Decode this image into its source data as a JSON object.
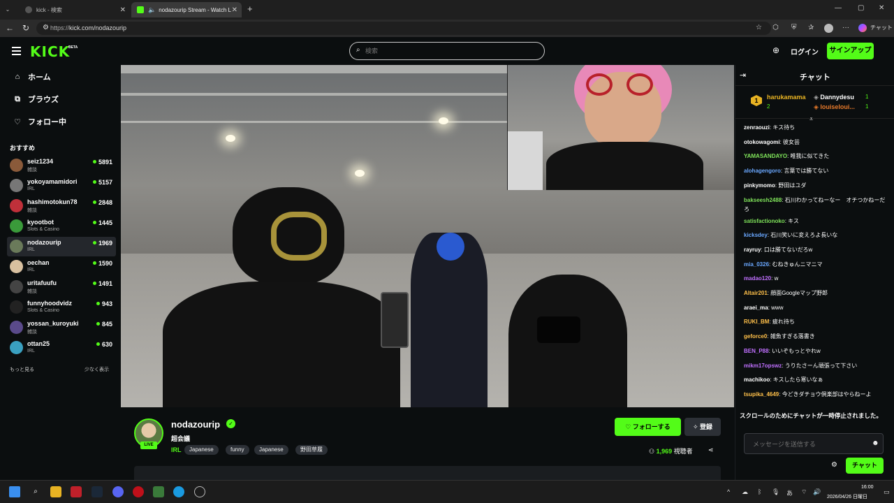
{
  "browser": {
    "tabs": [
      {
        "title": "kick - 検索",
        "active": false
      },
      {
        "title": "nodazourip Stream - Watch L",
        "active": true
      }
    ],
    "url_prefix": "https://",
    "url_main": "kick.com/nodazourip",
    "chat_ext_label": "チャット"
  },
  "header": {
    "logo": "KICK",
    "logo_badge": "BETA",
    "search_placeholder": "検索",
    "login": "ログイン",
    "signup": "サインアップ"
  },
  "sidebar": {
    "nav": [
      {
        "label": "ホーム",
        "icon": "home-icon"
      },
      {
        "label": "ブラウズ",
        "icon": "browse-icon"
      },
      {
        "label": "フォロー中",
        "icon": "heart-icon"
      }
    ],
    "recommended_title": "おすすめ",
    "channels": [
      {
        "name": "seiz1234",
        "category": "雑談",
        "viewers": "5891",
        "color": "#8a5a3a"
      },
      {
        "name": "yokoyamamidori",
        "category": "IRL",
        "viewers": "5157",
        "color": "#777"
      },
      {
        "name": "hashimotokun78",
        "category": "雑談",
        "viewers": "2848",
        "color": "#c0303a"
      },
      {
        "name": "kyootbot",
        "category": "Slots & Casino",
        "viewers": "1445",
        "color": "#3a9a3a"
      },
      {
        "name": "nodazourip",
        "category": "IRL",
        "viewers": "1969",
        "color": "#6a7a5a",
        "selected": true
      },
      {
        "name": "oechan",
        "category": "IRL",
        "viewers": "1590",
        "color": "#d8c0a0"
      },
      {
        "name": "uritafuufu",
        "category": "雑談",
        "viewers": "1491",
        "color": "#444"
      },
      {
        "name": "funnyhoodvidz",
        "category": "Slots & Casino",
        "viewers": "943",
        "color": "#222"
      },
      {
        "name": "yossan_kuroyuki",
        "category": "雑談",
        "viewers": "845",
        "color": "#5a4a8a"
      },
      {
        "name": "ottan25",
        "category": "IRL",
        "viewers": "630",
        "color": "#3aa0c0"
      }
    ],
    "show_more": "もっと見る",
    "show_less": "少なく表示"
  },
  "stream": {
    "live_badge": "LIVE",
    "streamer": "nodazourip",
    "title": "超会議",
    "category": "IRL",
    "tags": [
      "Japanese",
      "funny",
      "Japanese",
      "野田草履"
    ],
    "follow": "フォローする",
    "subscribe": "登録",
    "viewer_count": "1,969",
    "viewer_label": "視聴者"
  },
  "chat": {
    "title": "チャット",
    "gifters": [
      {
        "name": "harukamama",
        "count": "2",
        "rank": "1",
        "color": "#e8b323"
      },
      {
        "name": "Dannydesu",
        "count": "1",
        "color": "#fff"
      },
      {
        "name": "louiseloui...",
        "count": "1",
        "color": "#e87a2a"
      }
    ],
    "messages": [
      {
        "user": "zenraouzi",
        "text": "キス待ち",
        "color": "#ffffff"
      },
      {
        "user": "otokowagomi",
        "text": "彼女芸",
        "color": "#ffffff"
      },
      {
        "user": "YAMASANDAYO",
        "text": "唯我に似てきた",
        "color": "#7fe35a"
      },
      {
        "user": "alohagengoro",
        "text": "言葉では勝てない",
        "color": "#6aa8ff"
      },
      {
        "user": "pinkymomo",
        "text": "野田はユダ",
        "color": "#ffffff"
      },
      {
        "user": "bakseesh2488",
        "text": "石川わかってねーなー　オチつかねーだろ",
        "color": "#7fe35a"
      },
      {
        "user": "satisfactionoko",
        "text": "キス",
        "color": "#7fe35a"
      },
      {
        "user": "kicksdey",
        "text": "石川笑いに変えろよ長いな",
        "color": "#6aa8ff"
      },
      {
        "user": "rayruy",
        "text": "口は勝てないだろw",
        "color": "#ffffff"
      },
      {
        "user": "mia_0326",
        "text": "むねきゅんニマニマ",
        "color": "#6aa8ff"
      },
      {
        "user": "madao120",
        "text": "w",
        "color": "#c070ff"
      },
      {
        "user": "Altair201",
        "text": "顔面Googleマップ野郎",
        "color": "#ffc04a"
      },
      {
        "user": "araei_ma",
        "text": "www",
        "color": "#ffffff"
      },
      {
        "user": "RUKI_BM",
        "text": "疲れ待ち",
        "color": "#ffc04a"
      },
      {
        "user": "geforce0",
        "text": "雑魚すぎる落書き",
        "color": "#ffc04a"
      },
      {
        "user": "BEN_P88",
        "text": "いいぞもっとやれw",
        "color": "#c070ff"
      },
      {
        "user": "mikm17opswz",
        "text": "うりたさーん頑張って下さい",
        "color": "#c070ff"
      },
      {
        "user": "machikoo",
        "text": "キスしたら寒いなぁ",
        "color": "#ffffff"
      },
      {
        "user": "tsupika_4649",
        "text": "今どきダチョウ倶楽部はやらねーよ",
        "color": "#ffc04a"
      }
    ],
    "paused_notice": "スクロールのためにチャットが一時停止されました。",
    "input_placeholder": "メッセージを送信する",
    "send": "チャット"
  },
  "taskbar": {
    "time": "16:00",
    "date": "2026/04/26 日曜日"
  }
}
